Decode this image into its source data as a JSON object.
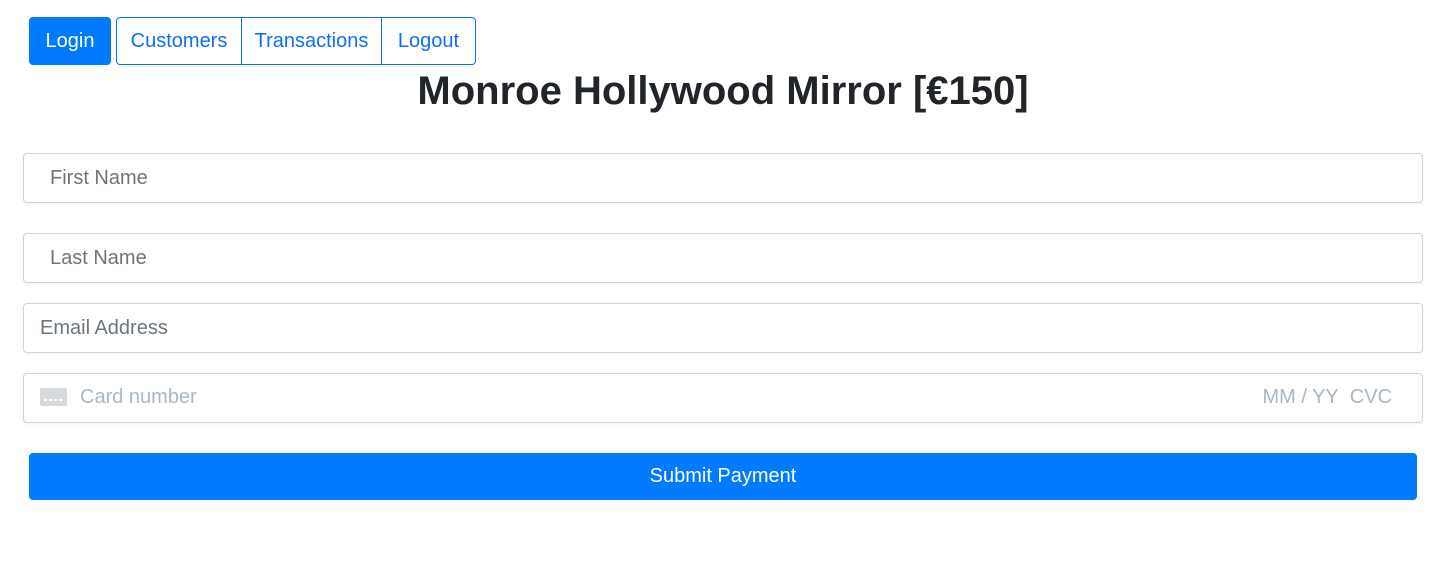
{
  "nav": {
    "login": "Login",
    "customers": "Customers",
    "transactions": "Transactions",
    "logout": "Logout"
  },
  "title": "Monroe Hollywood Mirror [€150]",
  "form": {
    "first_name_placeholder": "First Name",
    "last_name_placeholder": "Last Name",
    "email_placeholder": "Email Address",
    "card_number_placeholder": "Card number",
    "card_expiry_placeholder": "MM / YY",
    "card_cvc_placeholder": "CVC",
    "card_icon": "credit-card-icon",
    "submit_label": "Submit Payment"
  },
  "colors": {
    "accent": "#007bff",
    "placeholder": "#6c757d",
    "card_placeholder": "#aab7c4"
  }
}
